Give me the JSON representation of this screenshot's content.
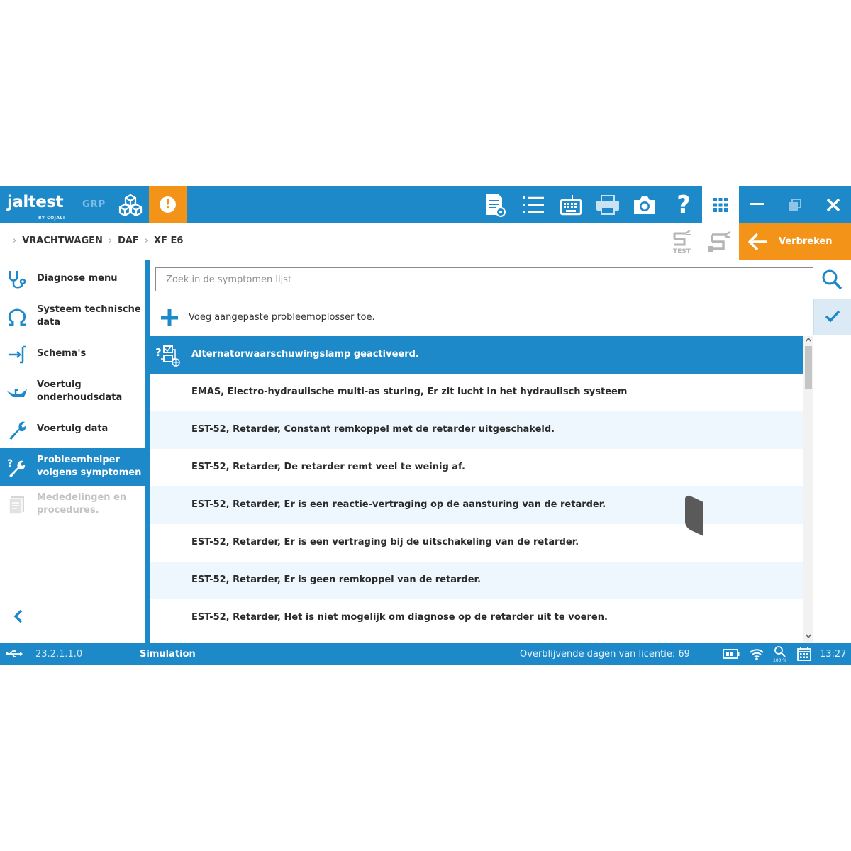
{
  "app": {
    "logo_text": "jaltest",
    "logo_sub": "BY COJALI",
    "product": "GRP",
    "alert_symbol": "!",
    "accent_color": "#1d89c9",
    "warning_color": "#f39419"
  },
  "toolbar": {
    "icons": [
      "report-icon",
      "list-icon",
      "keyboard-icon",
      "printer-icon",
      "camera-icon",
      "help-icon",
      "apps-grid-icon"
    ],
    "help_label": "?"
  },
  "breadcrumb": [
    "VRACHTWAGEN",
    "DAF",
    "XF E6"
  ],
  "connection": {
    "test_label": "TEST",
    "disconnect_label": "Verbreken"
  },
  "sidebar": {
    "items": [
      {
        "label_line1": "Diagnose menu",
        "label_line2": "",
        "icon": "stethoscope-icon"
      },
      {
        "label_line1": "Systeem technische",
        "label_line2": "data",
        "icon": "omega-icon"
      },
      {
        "label_line1": "Schema's",
        "label_line2": "",
        "icon": "schematic-icon"
      },
      {
        "label_line1": "Voertuig",
        "label_line2": "onderhoudsdata",
        "icon": "oil-can-icon"
      },
      {
        "label_line1": "Voertuig data",
        "label_line2": "",
        "icon": "wrench-icon"
      },
      {
        "label_line1": "Probleemhelper",
        "label_line2": "volgens symptomen",
        "icon": "troubleshoot-icon"
      },
      {
        "label_line1": "Mededelingen en",
        "label_line2": "procedures.",
        "icon": "documents-icon"
      }
    ],
    "active_index": 5
  },
  "search": {
    "placeholder": "Zoek in de symptomen lijst",
    "value": ""
  },
  "add_custom": {
    "label": "Voeg aangepaste probleemoplosser toe."
  },
  "symptoms": [
    {
      "label": "Alternatorwaarschuwingslamp geactiveerd.",
      "selected": true
    },
    {
      "label": "EMAS, Electro-hydraulische multi-as sturing, Er zit lucht in het hydraulisch systeem",
      "selected": false
    },
    {
      "label": "EST-52, Retarder, Constant remkoppel met de retarder uitgeschakeld.",
      "selected": false
    },
    {
      "label": "EST-52, Retarder, De retarder remt veel te weinig af.",
      "selected": false
    },
    {
      "label": "EST-52, Retarder, Er is een reactie-vertraging op de aansturing van de retarder.",
      "selected": false
    },
    {
      "label": "EST-52, Retarder, Er is een vertraging bij de uitschakeling van de retarder.",
      "selected": false
    },
    {
      "label": "EST-52, Retarder, Er is geen remkoppel van de retarder.",
      "selected": false
    },
    {
      "label": "EST-52, Retarder, Het is niet mogelijk om diagnose op de retarder uit te voeren.",
      "selected": false
    }
  ],
  "status": {
    "version": "23.2.1.1.0",
    "mode": "Simulation",
    "license": "Overblijvende dagen van licentie: 69",
    "zoom": "100 %",
    "time": "13:27"
  }
}
